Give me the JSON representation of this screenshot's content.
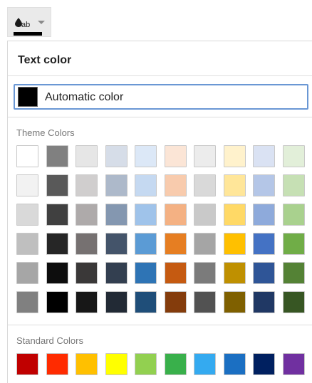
{
  "toolbar": {
    "button_label": "ab",
    "icon": "text-color-icon",
    "caret_icon": "chevron-down-icon",
    "current_color": "#000000"
  },
  "panel": {
    "title": "Text color",
    "automatic": {
      "label": "Automatic color",
      "color": "#000000"
    },
    "theme_label": "Theme Colors",
    "theme_colors": [
      [
        "#ffffff",
        "#808080",
        "#e6e6e6",
        "#d6dde8",
        "#dce8f7",
        "#fbe5d6",
        "#ececec",
        "#fff2cc",
        "#dae2f3",
        "#e2efd9"
      ],
      [
        "#f2f2f2",
        "#595959",
        "#d0cece",
        "#adb9ca",
        "#c5d9f1",
        "#f8cbad",
        "#d9d9d9",
        "#ffe699",
        "#b4c6e7",
        "#c6e0b4"
      ],
      [
        "#d9d9d9",
        "#404040",
        "#aeaaaa",
        "#8497b0",
        "#9fc3ea",
        "#f4b183",
        "#c9c9c9",
        "#ffd966",
        "#8eaadb",
        "#a9d18e"
      ],
      [
        "#bfbfbf",
        "#262626",
        "#767171",
        "#44546a",
        "#5b9bd5",
        "#e67e22",
        "#a5a5a5",
        "#ffc000",
        "#4472c4",
        "#70ad47"
      ],
      [
        "#a6a6a6",
        "#0d0d0d",
        "#3a3838",
        "#333f50",
        "#2e74b5",
        "#c55a11",
        "#7b7b7b",
        "#bf9000",
        "#2f5597",
        "#548235"
      ],
      [
        "#808080",
        "#000000",
        "#171717",
        "#222a35",
        "#1f4e79",
        "#843c0c",
        "#525252",
        "#7f6000",
        "#203864",
        "#375623"
      ]
    ],
    "standard_label": "Standard Colors",
    "standard_colors": [
      "#c00000",
      "#ff2b00",
      "#ffc000",
      "#ffff00",
      "#92d050",
      "#39b04b",
      "#34aaf0",
      "#1b6fc2",
      "#002060",
      "#7030a0"
    ]
  }
}
